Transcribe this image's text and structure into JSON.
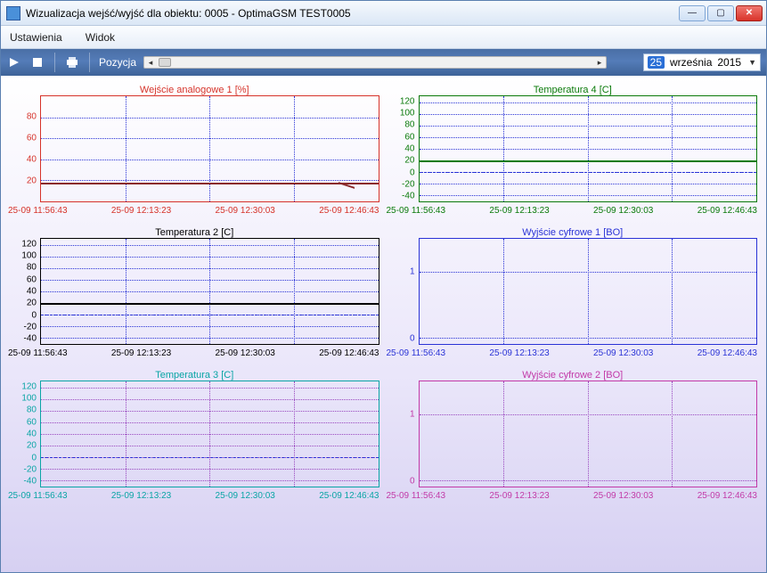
{
  "window": {
    "title": "Wizualizacja wejść/wyjść dla obiektu: 0005 - OptimaGSM TEST0005"
  },
  "menu": {
    "settings": "Ustawienia",
    "view": "Widok"
  },
  "toolbar": {
    "position_label": "Pozycja"
  },
  "date": {
    "day": "25",
    "month": "września",
    "year": "2015"
  },
  "x_ticks": [
    "25-09 11:56:43",
    "25-09 12:13:23",
    "25-09 12:30:03",
    "25-09 12:46:43"
  ],
  "chart_data": [
    {
      "id": "c0",
      "title": "Wejście analogowe 1 [%]",
      "title_color": "#d6332a",
      "axis_color": "#d6332a",
      "grid_color": "#2a33d6",
      "y_ticks": [
        20,
        40,
        60,
        80
      ],
      "y_range": [
        0,
        100
      ],
      "series": [
        {
          "name": "analog1",
          "color": "#8a2a2a",
          "const": 18,
          "jag": true
        }
      ]
    },
    {
      "id": "c1",
      "title": "Temperatura 4 [C]",
      "title_color": "#0a7a0a",
      "axis_color": "#0a7a0a",
      "grid_color": "#2a33d6",
      "y_ticks": [
        -40,
        -20,
        0,
        20,
        40,
        60,
        80,
        100,
        120
      ],
      "y_range": [
        -50,
        130
      ],
      "series": [
        {
          "name": "temp4",
          "color": "#0a7a0a",
          "const": 20
        },
        {
          "name": "zero",
          "color": "#2a33d6",
          "const": 0,
          "style": "dashed"
        }
      ]
    },
    {
      "id": "c2",
      "title": "Temperatura 2 [C]",
      "title_color": "#000000",
      "axis_color": "#000000",
      "grid_color": "#2a33d6",
      "y_ticks": [
        -40,
        -20,
        0,
        20,
        40,
        60,
        80,
        100,
        120
      ],
      "y_range": [
        -50,
        130
      ],
      "series": [
        {
          "name": "temp2",
          "color": "#000000",
          "const": 20
        },
        {
          "name": "zero",
          "color": "#2a33d6",
          "const": 0,
          "style": "dashed"
        }
      ]
    },
    {
      "id": "c3",
      "title": "Wyjście cyfrowe 1 [BO]",
      "title_color": "#2a33d6",
      "axis_color": "#2a33d6",
      "grid_color": "#2a33d6",
      "y_ticks": [
        0,
        1
      ],
      "y_range": [
        -0.1,
        1.5
      ],
      "series": []
    },
    {
      "id": "c4",
      "title": "Temperatura 3 [C]",
      "title_color": "#0aa5a5",
      "axis_color": "#0aa5a5",
      "grid_color": "#9a49c0",
      "y_ticks": [
        -40,
        -20,
        0,
        20,
        40,
        60,
        80,
        100,
        120
      ],
      "y_range": [
        -50,
        130
      ],
      "series": [
        {
          "name": "zero",
          "color": "#2a33d6",
          "const": 0,
          "style": "dashed"
        }
      ]
    },
    {
      "id": "c5",
      "title": "Wyjście cyfrowe 2 [BO]",
      "title_color": "#c23aa8",
      "axis_color": "#c23aa8",
      "grid_color": "#9a49c0",
      "y_ticks": [
        0,
        1
      ],
      "y_range": [
        -0.1,
        1.5
      ],
      "series": []
    }
  ]
}
